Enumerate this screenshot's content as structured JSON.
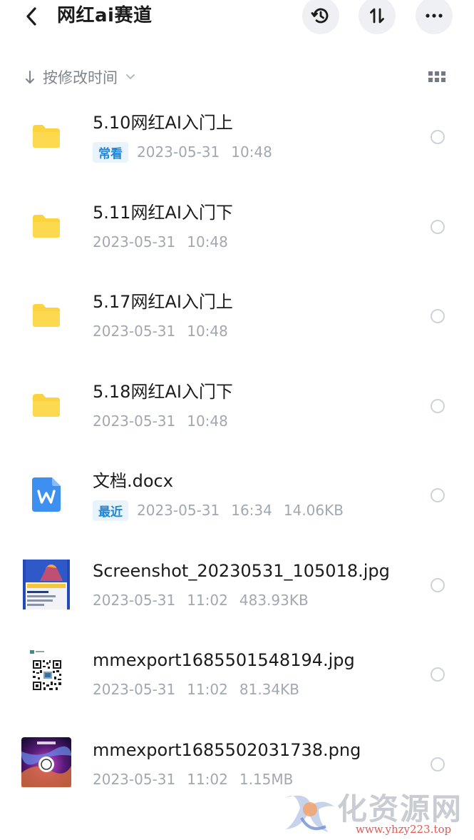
{
  "header": {
    "title": "网红ai赛道",
    "icons": {
      "back": "chevron-left-icon",
      "history": "history-icon",
      "sort": "sort-arrows-icon",
      "more": "more-dots-icon"
    }
  },
  "sortbar": {
    "label": "按修改时间",
    "icons": {
      "arrow": "arrow-down-icon",
      "chevron": "chevron-down-icon",
      "grid": "grid-view-icon"
    }
  },
  "files": [
    {
      "name": "5.10网红AI入门上",
      "badge": "常看",
      "date": "2023-05-31",
      "time": "10:48",
      "size": "",
      "icon": "folder-icon"
    },
    {
      "name": "5.11网红AI入门下",
      "badge": "",
      "date": "2023-05-31",
      "time": "10:48",
      "size": "",
      "icon": "folder-icon"
    },
    {
      "name": "5.17网红AI入门上",
      "badge": "",
      "date": "2023-05-31",
      "time": "10:48",
      "size": "",
      "icon": "folder-icon"
    },
    {
      "name": "5.18网红AI入门下",
      "badge": "",
      "date": "2023-05-31",
      "time": "10:48",
      "size": "",
      "icon": "folder-icon"
    },
    {
      "name": "文档.docx",
      "badge": "最近",
      "date": "2023-05-31",
      "time": "16:34",
      "size": "14.06KB",
      "icon": "word-doc-icon"
    },
    {
      "name": "Screenshot_20230531_105018.jpg",
      "badge": "",
      "date": "2023-05-31",
      "time": "11:02",
      "size": "483.93KB",
      "icon": "image-thumbnail"
    },
    {
      "name": "mmexport1685501548194.jpg",
      "badge": "",
      "date": "2023-05-31",
      "time": "11:02",
      "size": "81.34KB",
      "icon": "qr-image-thumbnail"
    },
    {
      "name": "mmexport1685502031738.png",
      "badge": "",
      "date": "2023-05-31",
      "time": "11:02",
      "size": "1.15MB",
      "icon": "image-thumbnail"
    }
  ],
  "watermark": {
    "chars": "化资源网",
    "url": "www.yhzy223.top"
  },
  "colors": {
    "folder": "#fcd33f",
    "accent": "#1f86d6",
    "word": "#3d8ff0",
    "meta": "#a2a8b0"
  }
}
